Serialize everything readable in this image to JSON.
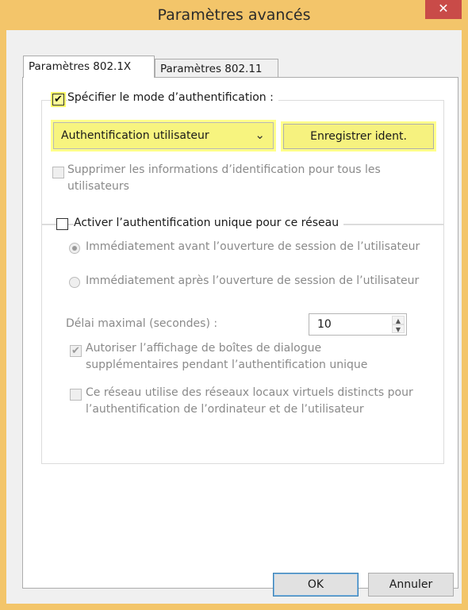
{
  "window": {
    "title": "Paramètres avancés",
    "close_glyph": "✕"
  },
  "tabs": [
    {
      "label": "Paramètres 802.1X",
      "active": true
    },
    {
      "label": "Paramètres 802.11",
      "active": false
    }
  ],
  "auth_group": {
    "specify_mode_label": "Spécifier le mode d’authentification :",
    "specify_mode_checked": true,
    "mode_select_value": "Authentification utilisateur",
    "save_credentials_button": "Enregistrer ident.",
    "delete_creds_label_line1": "Supprimer les informations d’identification pour tous les",
    "delete_creds_label_line2": "utilisateurs",
    "delete_creds_checked": false
  },
  "sso_group": {
    "enable_sso_label": "Activer l’authentification unique pour ce réseau",
    "enable_sso_checked": false,
    "radio_before_label": "Immédiatement avant l’ouverture de session de l’utilisateur",
    "radio_after_label": "Immédiatement après l’ouverture de session de l’utilisateur",
    "max_delay_label": "Délai maximal (secondes) :",
    "max_delay_value": "10",
    "allow_dialogs_line1": "Autoriser l’affichage de boîtes de dialogue",
    "allow_dialogs_line2": "supplémentaires pendant l’authentification unique",
    "allow_dialogs_checked": true,
    "vlan_line1": "Ce réseau utilise des réseaux locaux virtuels distincts pour",
    "vlan_line2": "l’authentification de l’ordinateur et de l’utilisateur",
    "vlan_checked": false
  },
  "footer": {
    "ok_label": "OK",
    "cancel_label": "Annuler"
  },
  "colors": {
    "frame": "#f3c56a",
    "highlight": "#ffff8a",
    "close_button": "#c94b48"
  }
}
